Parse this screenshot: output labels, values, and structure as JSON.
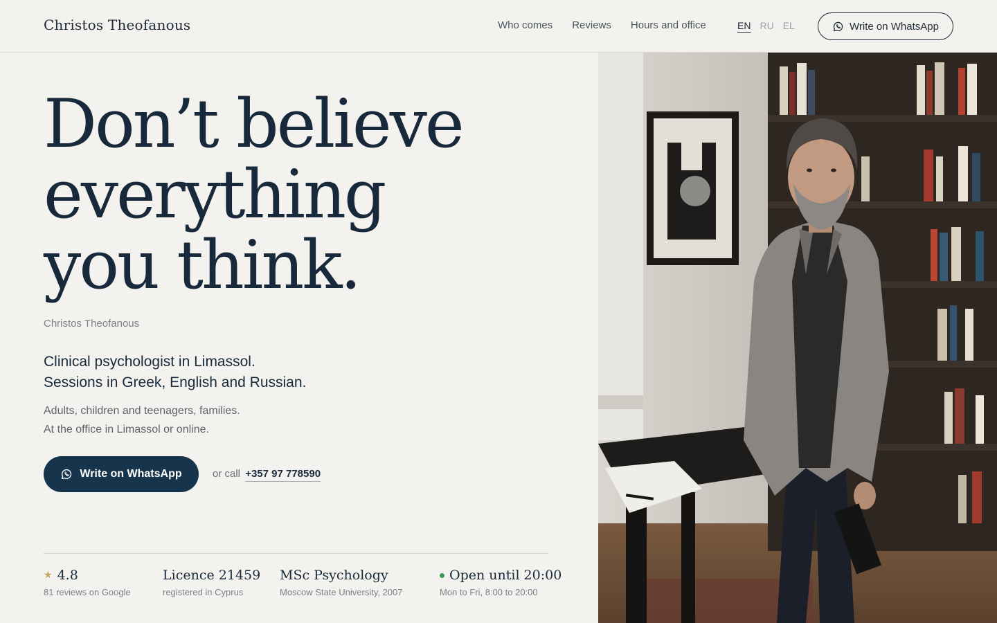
{
  "header": {
    "brand": "Christos Theofanous",
    "nav": [
      "Who comes",
      "Reviews",
      "Hours and office"
    ],
    "languages": [
      "EN",
      "RU",
      "EL"
    ],
    "active_language": "EN",
    "cta_label": "Write on WhatsApp"
  },
  "hero": {
    "headline_lines": [
      "Don’t believe",
      "everything",
      "you think."
    ],
    "signature": "Christos Theofanous",
    "lede_lines": [
      "Clinical psychologist in Limassol.",
      "Sessions in Greek, English and Russian."
    ],
    "sub_lines": [
      "Adults, children and teenagers, families.",
      "At the office in Limassol or online."
    ],
    "primary_cta": "Write on WhatsApp",
    "call_prefix": "or call",
    "phone": "+357 97 778590"
  },
  "stats": [
    {
      "value": "4.8",
      "caption": "81 reviews on Google",
      "icon": "star-icon"
    },
    {
      "value": "Licence 21459",
      "caption": "registered in Cyprus"
    },
    {
      "value": "MSc Psychology",
      "caption": "Moscow State University, 2007"
    },
    {
      "value": "Open until 20:00",
      "caption": "Mon to Fri, 8:00 to 20:00",
      "icon": "status-dot-icon"
    }
  ],
  "colors": {
    "background": "#f3f2ee",
    "primary": "#17344d",
    "text": "#17293a",
    "star": "#c8a15a",
    "open_status": "#3e9a5c"
  }
}
